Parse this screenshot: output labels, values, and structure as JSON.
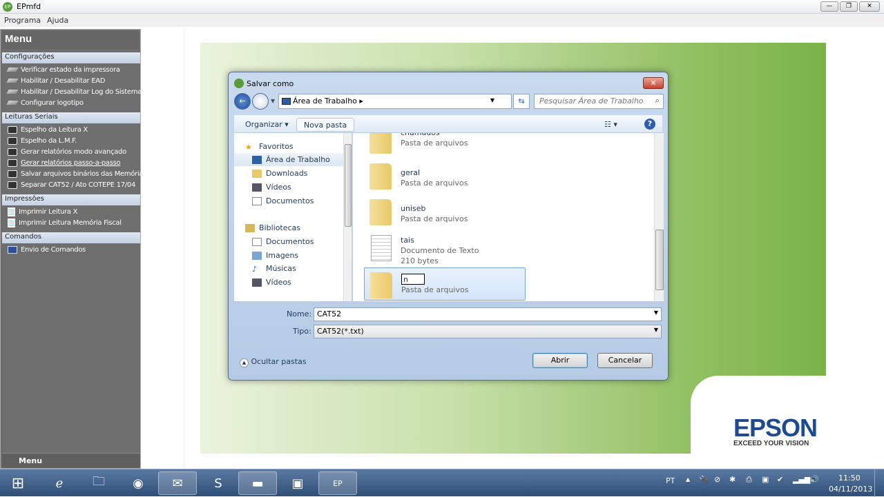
{
  "window": {
    "title": "EPmfd",
    "icon": "EP"
  },
  "menubar": [
    "Programa",
    "Ajuda"
  ],
  "sidebar": {
    "title": "Menu",
    "footer": "Menu",
    "sections": [
      {
        "label": "Configurações",
        "items": [
          {
            "label": "Verificar estado da impressora",
            "icon": "printer-icon"
          },
          {
            "label": "Habilitar / Desabilitar EAD",
            "icon": "printer-icon"
          },
          {
            "label": "Habilitar / Desabilitar Log do Sistema",
            "icon": "printer-icon"
          },
          {
            "label": "Configurar logotipo",
            "icon": "printer-icon"
          }
        ]
      },
      {
        "label": "Leituras Seriais",
        "items": [
          {
            "label": "Espelho da Leitura X"
          },
          {
            "label": "Espelho da L.M.F."
          },
          {
            "label": "Gerar relatórios modo avançado"
          },
          {
            "label": "Gerar relatórios passo-a-passo",
            "hovered": true
          },
          {
            "label": "Salvar arquivos binários das Memórias"
          },
          {
            "label": "Separar CAT52 / Ato COTEPE 17/04"
          }
        ]
      },
      {
        "label": "Impressões",
        "items": [
          {
            "label": "Imprimir Leitura X"
          },
          {
            "label": "Imprimir Leitura Memória Fiscal"
          }
        ]
      },
      {
        "label": "Comandos",
        "items": [
          {
            "label": "Envio de Comandos"
          }
        ]
      }
    ]
  },
  "brand": {
    "logo": "EPSON",
    "tagline": "EXCEED YOUR VISION",
    "color": "#1d4a93"
  },
  "dialog": {
    "title": "Salvar como",
    "address": "Área de Trabalho",
    "search_placeholder": "Pesquisar Área de Trabalho",
    "toolbar": {
      "organize": "Organizar",
      "new_folder": "Nova pasta"
    },
    "nav": [
      {
        "label": "Favoritos",
        "level": 0
      },
      {
        "label": "Área de Trabalho",
        "level": 1,
        "selected": true
      },
      {
        "label": "Downloads",
        "level": 1
      },
      {
        "label": "Vídeos",
        "level": 1
      },
      {
        "label": "Documentos",
        "level": 1
      },
      {
        "label": "Bibliotecas",
        "level": 0
      },
      {
        "label": "Documentos",
        "level": 1
      },
      {
        "label": "Imagens",
        "level": 1
      },
      {
        "label": "Músicas",
        "level": 1
      },
      {
        "label": "Vídeos",
        "level": 1
      }
    ],
    "files": [
      {
        "name": "chamados",
        "type": "Pasta de arquivos"
      },
      {
        "name": "geral",
        "type": "Pasta de arquivos"
      },
      {
        "name": "uniseb",
        "type": "Pasta de arquivos"
      },
      {
        "name": "tais",
        "type": "Documento de Texto",
        "size": "210 bytes"
      },
      {
        "name": "n",
        "type": "Pasta de arquivos",
        "editing": true
      }
    ],
    "name_label": "Nome:",
    "name_value": "CAT52",
    "type_label": "Tipo:",
    "type_value": "CAT52(*.txt)",
    "hide_folders": "Ocultar pastas",
    "open": "Abrir",
    "cancel": "Cancelar"
  },
  "taskbar": {
    "lang": "PT",
    "time": "11:50",
    "date": "04/11/2013"
  }
}
